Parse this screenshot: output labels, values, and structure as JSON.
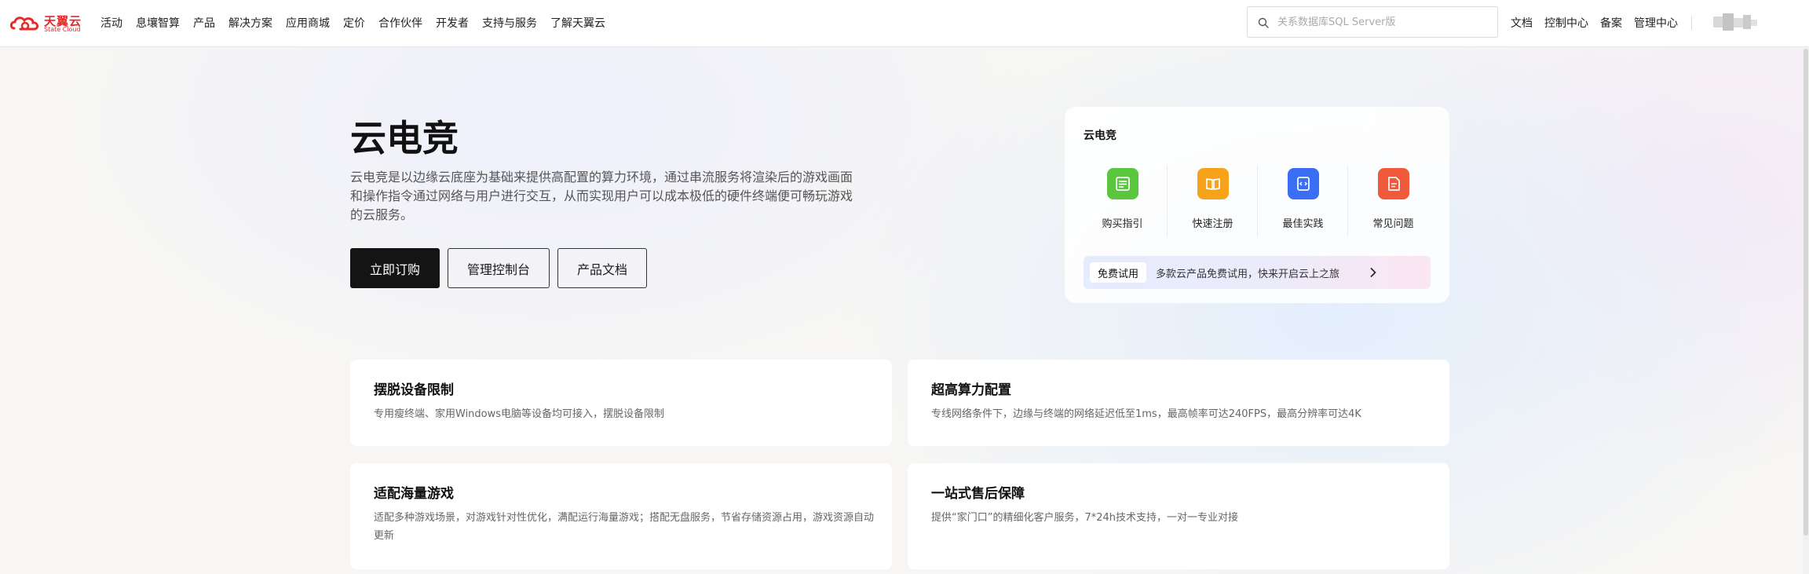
{
  "header": {
    "logo": {
      "cn": "天翼云",
      "en": "State Cloud",
      "color": "#e52a2a"
    },
    "nav": [
      "活动",
      "息壤智算",
      "产品",
      "解决方案",
      "应用商城",
      "定价",
      "合作伙伴",
      "开发者",
      "支持与服务",
      "了解天翼云"
    ],
    "search": {
      "placeholder": "关系数据库SQL Server版",
      "value": ""
    },
    "links": [
      "文档",
      "控制中心",
      "备案",
      "管理中心"
    ]
  },
  "hero": {
    "title": "云电竞",
    "description": "云电竞是以边缘云底座为基础来提供高配置的算力环境，通过串流服务将渲染后的游戏画面和操作指令通过网络与用户进行交互，从而实现用户可以成本极低的硬件终端便可畅玩游戏的云服务。",
    "buttons": {
      "order": "立即订购",
      "console": "管理控制台",
      "docs": "产品文档"
    }
  },
  "quick": {
    "title": "云电竞",
    "items": [
      {
        "label": "购买指引",
        "icon": "purchase-guide-icon",
        "color": "#5ac63d"
      },
      {
        "label": "快速注册",
        "icon": "book-icon",
        "color": "#f6a21b"
      },
      {
        "label": "最佳实践",
        "icon": "code-doc-icon",
        "color": "#3a6ef4"
      },
      {
        "label": "常见问题",
        "icon": "faq-doc-icon",
        "color": "#f05a3a"
      }
    ],
    "promo": {
      "badge": "免费试用",
      "text": "多款云产品免费试用，快来开启云上之旅"
    }
  },
  "features": [
    {
      "title": "摆脱设备限制",
      "desc": "专用瘦终端、家用Windows电脑等设备均可接入，摆脱设备限制"
    },
    {
      "title": "超高算力配置",
      "desc": "专线网络条件下，边缘与终端的网络延迟低至1ms，最高帧率可达240FPS，最高分辨率可达4K"
    },
    {
      "title": "适配海量游戏",
      "desc": "适配多种游戏场景，对游戏针对性优化，满配运行海量游戏；搭配无盘服务，节省存储资源占用，游戏资源自动更新"
    },
    {
      "title": "一站式售后保障",
      "desc": "提供“家门口”的精细化客户服务，7*24h技术支持，一对一专业对接"
    }
  ]
}
